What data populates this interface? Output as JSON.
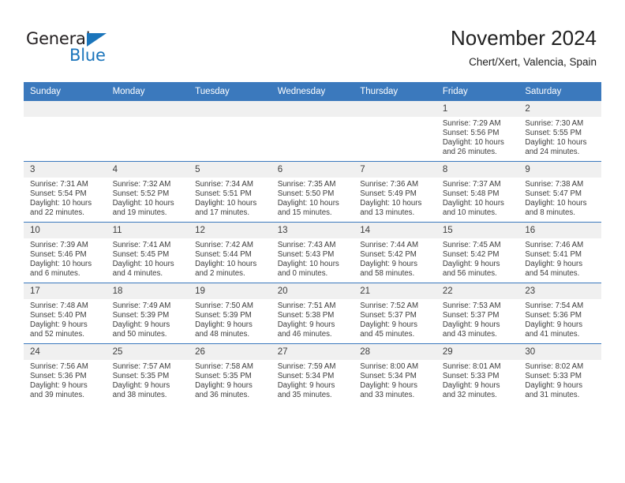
{
  "logo": {
    "word1": "General",
    "word2": "Blue",
    "triangle_color": "#1b75bb",
    "text_color": "#231f20"
  },
  "header": {
    "title": "November 2024",
    "subtitle": "Chert/Xert, Valencia, Spain"
  },
  "theme": {
    "header_blue": "#3b79bd",
    "daynum_band": "#f0f0f0",
    "text": "#3c3c3c"
  },
  "weekdays": [
    "Sunday",
    "Monday",
    "Tuesday",
    "Wednesday",
    "Thursday",
    "Friday",
    "Saturday"
  ],
  "labels": {
    "sunrise": "Sunrise:",
    "sunset": "Sunset:",
    "daylight": "Daylight:"
  },
  "weeks": [
    [
      {
        "day": "",
        "sunrise": "",
        "sunset": "",
        "daylight": ""
      },
      {
        "day": "",
        "sunrise": "",
        "sunset": "",
        "daylight": ""
      },
      {
        "day": "",
        "sunrise": "",
        "sunset": "",
        "daylight": ""
      },
      {
        "day": "",
        "sunrise": "",
        "sunset": "",
        "daylight": ""
      },
      {
        "day": "",
        "sunrise": "",
        "sunset": "",
        "daylight": ""
      },
      {
        "day": "1",
        "sunrise": "Sunrise: 7:29 AM",
        "sunset": "Sunset: 5:56 PM",
        "daylight": "Daylight: 10 hours and 26 minutes."
      },
      {
        "day": "2",
        "sunrise": "Sunrise: 7:30 AM",
        "sunset": "Sunset: 5:55 PM",
        "daylight": "Daylight: 10 hours and 24 minutes."
      }
    ],
    [
      {
        "day": "3",
        "sunrise": "Sunrise: 7:31 AM",
        "sunset": "Sunset: 5:54 PM",
        "daylight": "Daylight: 10 hours and 22 minutes."
      },
      {
        "day": "4",
        "sunrise": "Sunrise: 7:32 AM",
        "sunset": "Sunset: 5:52 PM",
        "daylight": "Daylight: 10 hours and 19 minutes."
      },
      {
        "day": "5",
        "sunrise": "Sunrise: 7:34 AM",
        "sunset": "Sunset: 5:51 PM",
        "daylight": "Daylight: 10 hours and 17 minutes."
      },
      {
        "day": "6",
        "sunrise": "Sunrise: 7:35 AM",
        "sunset": "Sunset: 5:50 PM",
        "daylight": "Daylight: 10 hours and 15 minutes."
      },
      {
        "day": "7",
        "sunrise": "Sunrise: 7:36 AM",
        "sunset": "Sunset: 5:49 PM",
        "daylight": "Daylight: 10 hours and 13 minutes."
      },
      {
        "day": "8",
        "sunrise": "Sunrise: 7:37 AM",
        "sunset": "Sunset: 5:48 PM",
        "daylight": "Daylight: 10 hours and 10 minutes."
      },
      {
        "day": "9",
        "sunrise": "Sunrise: 7:38 AM",
        "sunset": "Sunset: 5:47 PM",
        "daylight": "Daylight: 10 hours and 8 minutes."
      }
    ],
    [
      {
        "day": "10",
        "sunrise": "Sunrise: 7:39 AM",
        "sunset": "Sunset: 5:46 PM",
        "daylight": "Daylight: 10 hours and 6 minutes."
      },
      {
        "day": "11",
        "sunrise": "Sunrise: 7:41 AM",
        "sunset": "Sunset: 5:45 PM",
        "daylight": "Daylight: 10 hours and 4 minutes."
      },
      {
        "day": "12",
        "sunrise": "Sunrise: 7:42 AM",
        "sunset": "Sunset: 5:44 PM",
        "daylight": "Daylight: 10 hours and 2 minutes."
      },
      {
        "day": "13",
        "sunrise": "Sunrise: 7:43 AM",
        "sunset": "Sunset: 5:43 PM",
        "daylight": "Daylight: 10 hours and 0 minutes."
      },
      {
        "day": "14",
        "sunrise": "Sunrise: 7:44 AM",
        "sunset": "Sunset: 5:42 PM",
        "daylight": "Daylight: 9 hours and 58 minutes."
      },
      {
        "day": "15",
        "sunrise": "Sunrise: 7:45 AM",
        "sunset": "Sunset: 5:42 PM",
        "daylight": "Daylight: 9 hours and 56 minutes."
      },
      {
        "day": "16",
        "sunrise": "Sunrise: 7:46 AM",
        "sunset": "Sunset: 5:41 PM",
        "daylight": "Daylight: 9 hours and 54 minutes."
      }
    ],
    [
      {
        "day": "17",
        "sunrise": "Sunrise: 7:48 AM",
        "sunset": "Sunset: 5:40 PM",
        "daylight": "Daylight: 9 hours and 52 minutes."
      },
      {
        "day": "18",
        "sunrise": "Sunrise: 7:49 AM",
        "sunset": "Sunset: 5:39 PM",
        "daylight": "Daylight: 9 hours and 50 minutes."
      },
      {
        "day": "19",
        "sunrise": "Sunrise: 7:50 AM",
        "sunset": "Sunset: 5:39 PM",
        "daylight": "Daylight: 9 hours and 48 minutes."
      },
      {
        "day": "20",
        "sunrise": "Sunrise: 7:51 AM",
        "sunset": "Sunset: 5:38 PM",
        "daylight": "Daylight: 9 hours and 46 minutes."
      },
      {
        "day": "21",
        "sunrise": "Sunrise: 7:52 AM",
        "sunset": "Sunset: 5:37 PM",
        "daylight": "Daylight: 9 hours and 45 minutes."
      },
      {
        "day": "22",
        "sunrise": "Sunrise: 7:53 AM",
        "sunset": "Sunset: 5:37 PM",
        "daylight": "Daylight: 9 hours and 43 minutes."
      },
      {
        "day": "23",
        "sunrise": "Sunrise: 7:54 AM",
        "sunset": "Sunset: 5:36 PM",
        "daylight": "Daylight: 9 hours and 41 minutes."
      }
    ],
    [
      {
        "day": "24",
        "sunrise": "Sunrise: 7:56 AM",
        "sunset": "Sunset: 5:36 PM",
        "daylight": "Daylight: 9 hours and 39 minutes."
      },
      {
        "day": "25",
        "sunrise": "Sunrise: 7:57 AM",
        "sunset": "Sunset: 5:35 PM",
        "daylight": "Daylight: 9 hours and 38 minutes."
      },
      {
        "day": "26",
        "sunrise": "Sunrise: 7:58 AM",
        "sunset": "Sunset: 5:35 PM",
        "daylight": "Daylight: 9 hours and 36 minutes."
      },
      {
        "day": "27",
        "sunrise": "Sunrise: 7:59 AM",
        "sunset": "Sunset: 5:34 PM",
        "daylight": "Daylight: 9 hours and 35 minutes."
      },
      {
        "day": "28",
        "sunrise": "Sunrise: 8:00 AM",
        "sunset": "Sunset: 5:34 PM",
        "daylight": "Daylight: 9 hours and 33 minutes."
      },
      {
        "day": "29",
        "sunrise": "Sunrise: 8:01 AM",
        "sunset": "Sunset: 5:33 PM",
        "daylight": "Daylight: 9 hours and 32 minutes."
      },
      {
        "day": "30",
        "sunrise": "Sunrise: 8:02 AM",
        "sunset": "Sunset: 5:33 PM",
        "daylight": "Daylight: 9 hours and 31 minutes."
      }
    ]
  ]
}
